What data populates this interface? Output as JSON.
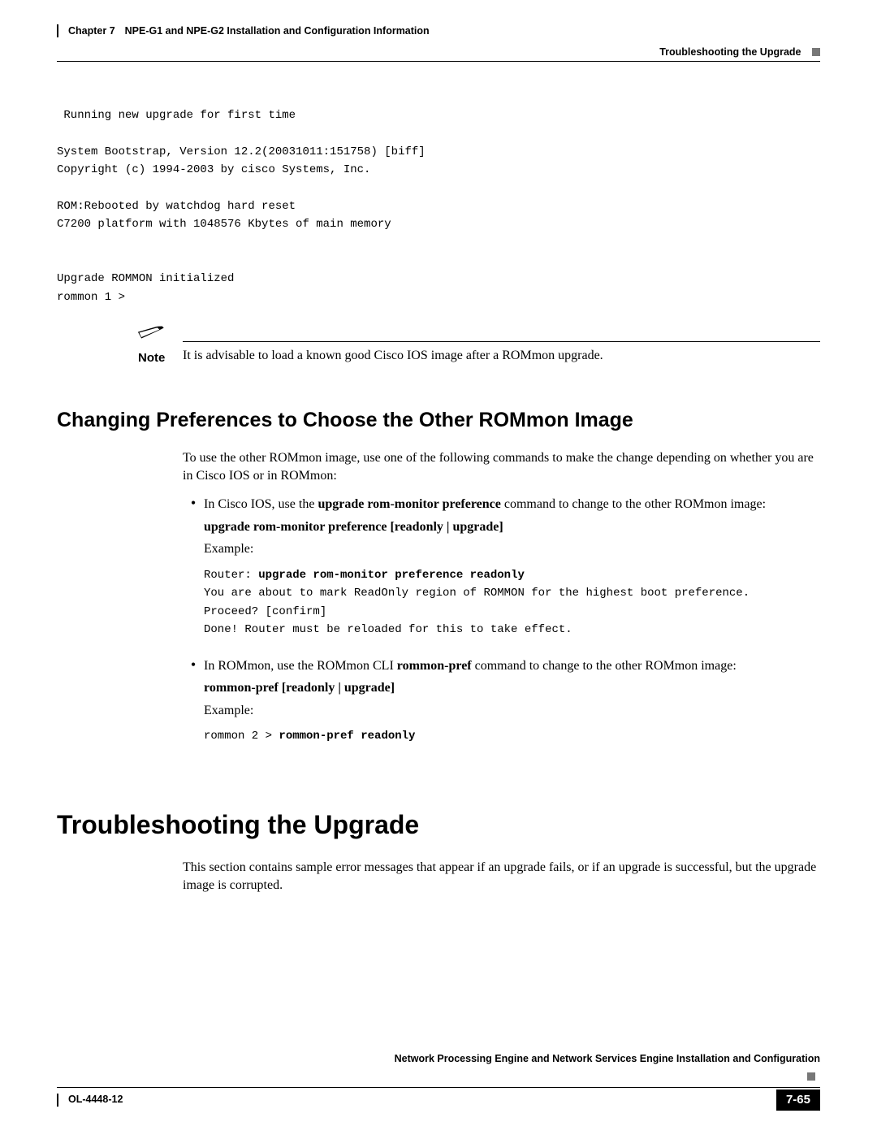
{
  "header": {
    "chapter_label": "Chapter 7",
    "chapter_title": "NPE-G1 and NPE-G2 Installation and Configuration Information",
    "section_title": "Troubleshooting the Upgrade"
  },
  "top_code_lines": [
    " Running new upgrade for first time",
    "",
    "System Bootstrap, Version 12.2(20031011:151758) [biff]",
    "Copyright (c) 1994-2003 by cisco Systems, Inc.",
    "",
    "ROM:Rebooted by watchdog hard reset",
    "C7200 platform with 1048576 Kbytes of main memory",
    "",
    "",
    "Upgrade ROMMON initialized",
    "rommon 1 >"
  ],
  "note": {
    "label": "Note",
    "text": "It is advisable to load a known good Cisco IOS image after a ROMmon upgrade."
  },
  "sectionA": {
    "heading": "Changing Preferences to Choose the Other ROMmon Image",
    "intro": "To use the other ROMmon image, use one of the following commands to make the change depending on whether you are in Cisco IOS or in ROMmon:",
    "bullet1_pre": "In Cisco IOS, use the ",
    "bullet1_cmd": "upgrade rom-monitor preference",
    "bullet1_post": " command to change to the other ROMmon image:",
    "syntax1": "upgrade rom-monitor preference [readonly | upgrade]",
    "example_label": "Example:",
    "example1_prefix": "Router: ",
    "example1_cmd": "upgrade rom-monitor preference readonly",
    "example1_rest_lines": [
      "You are about to mark ReadOnly region of ROMMON for the highest boot preference.",
      "Proceed? [confirm]",
      "Done! Router must be reloaded for this to take effect."
    ],
    "bullet2_pre": "In ROMmon, use the ROMmon CLI ",
    "bullet2_cmd": "rommon-pref",
    "bullet2_post": " command to change to the other ROMmon image:",
    "syntax2": "rommon-pref [readonly | upgrade]",
    "example2_prefix": "rommon 2 > ",
    "example2_cmd": "rommon-pref readonly"
  },
  "sectionB": {
    "heading": "Troubleshooting the Upgrade",
    "intro": "This section contains sample error messages that appear if an upgrade fails, or if an upgrade is successful, but the upgrade image is corrupted."
  },
  "footer": {
    "book_title": "Network Processing Engine and Network Services Engine Installation and Configuration",
    "doc_id": "OL-4448-12",
    "page_number": "7-65"
  }
}
